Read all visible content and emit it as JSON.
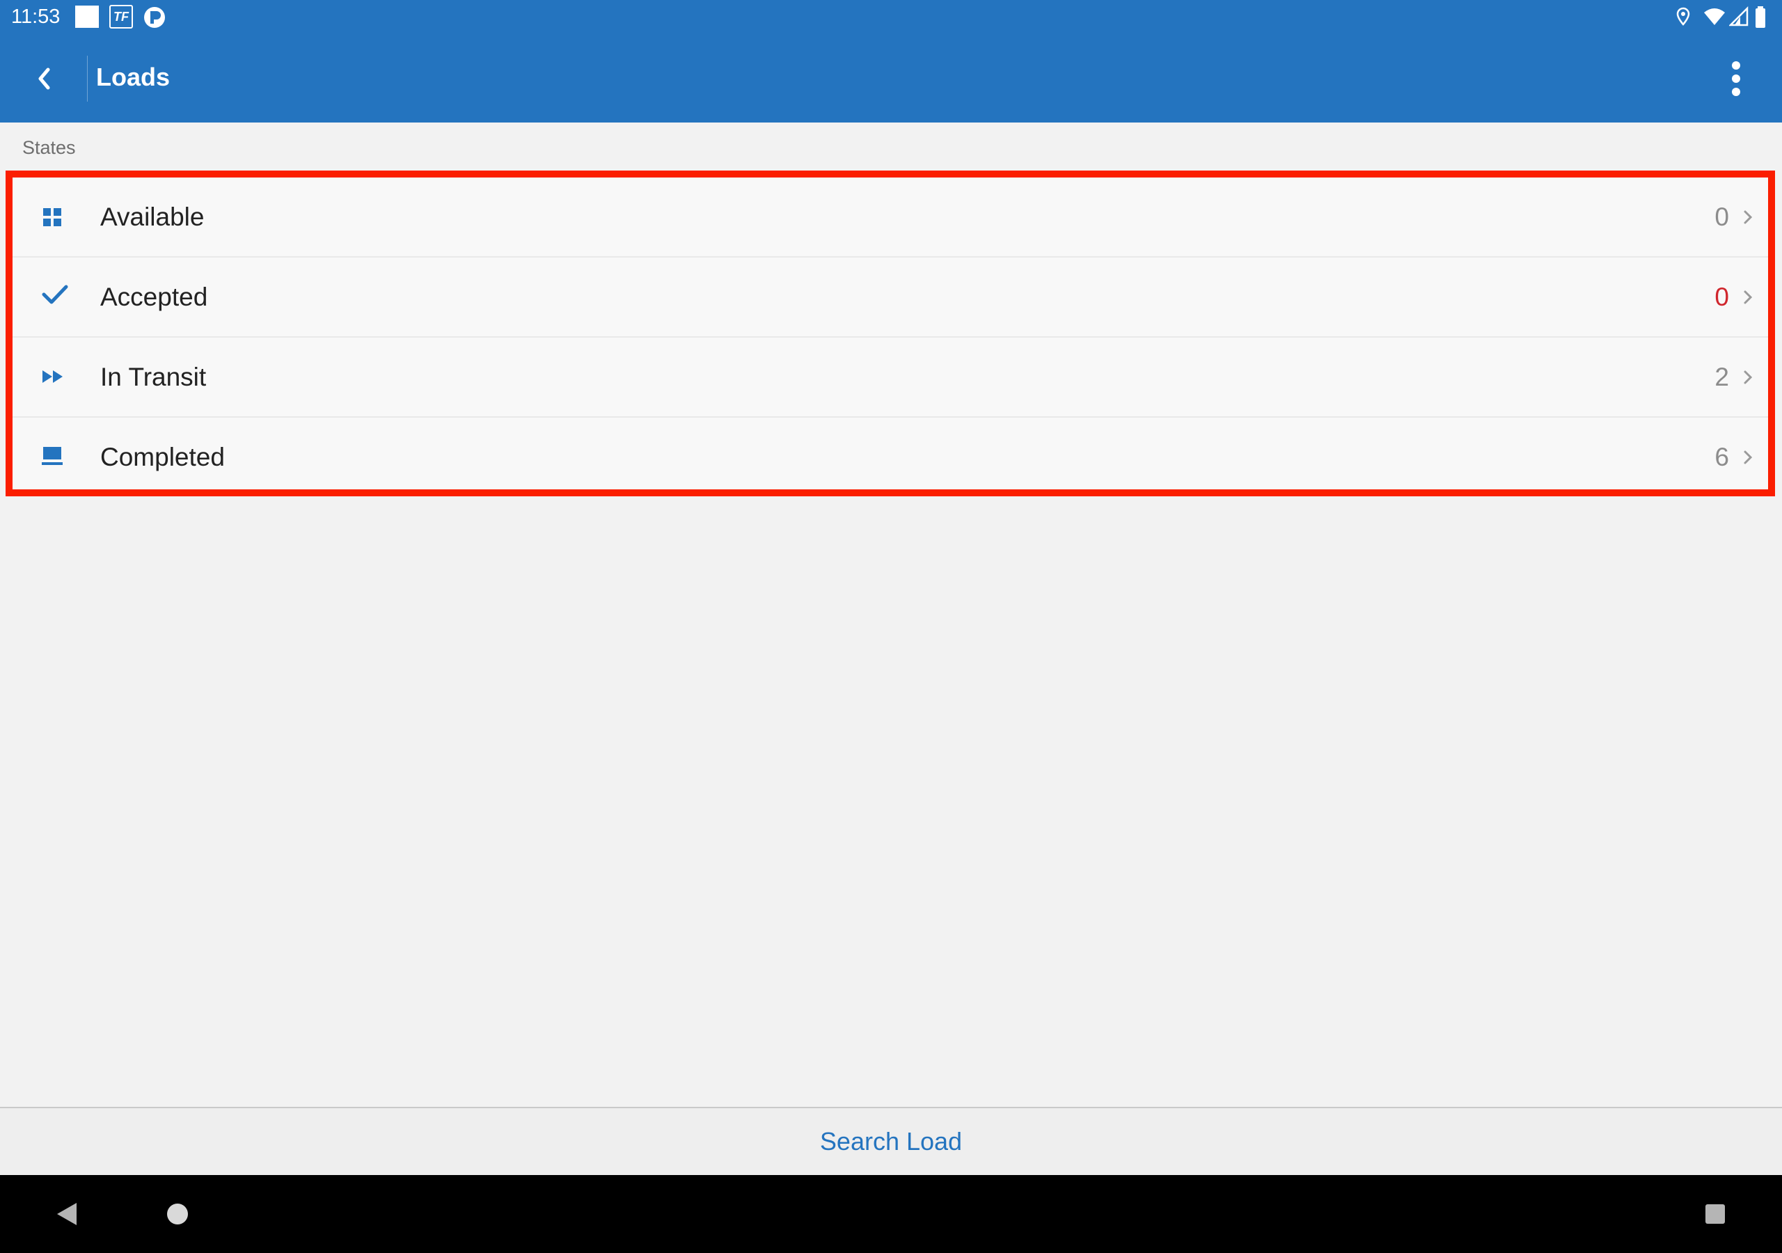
{
  "status_bar": {
    "time": "11:53",
    "tf_badge": "TF",
    "icons": [
      "notification-square-icon",
      "tf-mobile-icon",
      "app-circle-icon",
      "location-icon",
      "wifi-icon",
      "signal-icon",
      "battery-icon"
    ]
  },
  "app_bar": {
    "title": "Loads",
    "back_icon": "chevron-left-icon",
    "menu_icon": "more-vertical-icon"
  },
  "section": {
    "header": "States"
  },
  "states": [
    {
      "label": "Available",
      "count": "0",
      "icon": "grid-icon",
      "count_color": "#8c8c8c"
    },
    {
      "label": "Accepted",
      "count": "0",
      "icon": "check-icon",
      "count_color": "#d0262d"
    },
    {
      "label": "In Transit",
      "count": "2",
      "icon": "fast-forward-icon",
      "count_color": "#8c8c8c"
    },
    {
      "label": "Completed",
      "count": "6",
      "icon": "tray-icon",
      "count_color": "#8c8c8c"
    }
  ],
  "bottom_action": {
    "label": "Search Load"
  },
  "nav_bar": {
    "icons": [
      "back-triangle-icon",
      "home-circle-icon",
      "recents-square-icon"
    ]
  },
  "colors": {
    "primary": "#2474bf",
    "highlight_border": "#fb1e00",
    "alert": "#d0262d",
    "background": "#f2f2f2"
  }
}
